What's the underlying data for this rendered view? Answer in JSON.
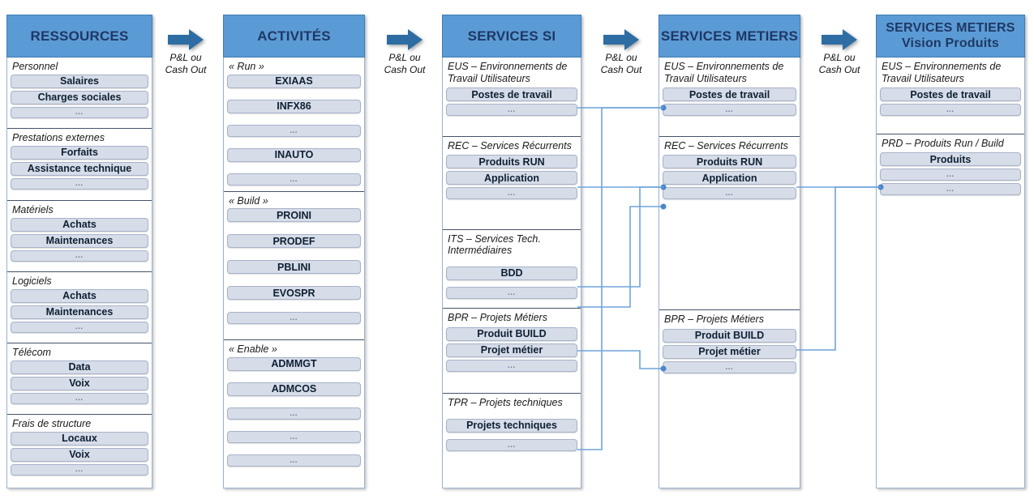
{
  "diagram": {
    "title": "Chaine de valeur IT - Ressources vers Services Metiers",
    "colors": {
      "header_blue": "#5B9BD5",
      "header_text": "#1F3864",
      "pill_fill": "#D6DCE8",
      "pill_border": "#A6B3CA",
      "arrow_blue": "#2E6DA4",
      "connector_blue": "#5B9BD5",
      "section_divider": "#44546A"
    },
    "connector_label": "P&L ou Cash Out",
    "connector_label_line1": "P&L ou",
    "connector_label_line2": "Cash Out",
    "arrow_icon": "right-block-arrow"
  },
  "columns": [
    {
      "id": "ressources",
      "header_lines": [
        "RESSOURCES"
      ],
      "sections": [
        {
          "title": "Personnel",
          "items": [
            "Salaires",
            "Charges sociales",
            "…"
          ]
        },
        {
          "title": "Prestations externes",
          "items": [
            "Forfaits",
            "Assistance technique",
            "…"
          ]
        },
        {
          "title": "Matériels",
          "items": [
            "Achats",
            "Maintenances",
            "…"
          ]
        },
        {
          "title": "Logiciels",
          "items": [
            "Achats",
            "Maintenances",
            "…"
          ]
        },
        {
          "title": "Télécom",
          "items": [
            "Data",
            "Voix",
            "…"
          ]
        },
        {
          "title": "Frais de structure",
          "items": [
            "Locaux",
            "Voix",
            "…"
          ]
        }
      ]
    },
    {
      "id": "activites",
      "header_lines": [
        "ACTIVITÉS"
      ],
      "sections": [
        {
          "title": "« Run »",
          "items": [
            "EXIAAS",
            "INFX86",
            "…",
            "INAUTO",
            "…"
          ]
        },
        {
          "title": "« Build »",
          "items": [
            "PROINI",
            "PRODEF",
            "PBLINI",
            "EVOSPR",
            "…"
          ]
        },
        {
          "title": "« Enable »",
          "items": [
            "ADMMGT",
            "ADMCOS",
            "…",
            "…",
            "…"
          ]
        }
      ]
    },
    {
      "id": "services-si",
      "header_lines": [
        "SERVICES SI"
      ],
      "sections": [
        {
          "title": "EUS – Environnements de Travail Utilisateurs",
          "items": [
            "Postes de travail",
            "…"
          ]
        },
        {
          "title": "REC – Services Récurrents",
          "items": [
            "Produits RUN",
            "Application",
            "…"
          ]
        },
        {
          "title": "ITS – Services Tech. Intermédiaires",
          "items": [
            "BDD",
            "…"
          ]
        },
        {
          "title": "BPR – Projets Métiers",
          "items": [
            "Produit BUILD",
            "Projet métier",
            "…"
          ]
        },
        {
          "title": "TPR – Projets techniques",
          "items": [
            "Projets techniques",
            "…"
          ]
        }
      ]
    },
    {
      "id": "services-metiers",
      "header_lines": [
        "SERVICES METIERS"
      ],
      "sections": [
        {
          "title": "EUS – Environnements de Travail Utilisateurs",
          "items": [
            "Postes de travail",
            "…"
          ]
        },
        {
          "title": "REC – Services Récurrents",
          "items": [
            "Produits RUN",
            "Application",
            "…"
          ]
        },
        {
          "title": "BPR – Projets Métiers",
          "items": [
            "Produit BUILD",
            "Projet métier",
            "…"
          ]
        }
      ]
    },
    {
      "id": "services-metiers-vision-produits",
      "header_lines": [
        "SERVICES METIERS",
        "Vision Produits"
      ],
      "sections": [
        {
          "title": "EUS – Environnements de Travail Utilisateurs",
          "items": [
            "Postes de travail",
            "…"
          ]
        },
        {
          "title": "PRD – Produits Run / Build",
          "items": [
            "Produits",
            "…",
            "…"
          ]
        }
      ]
    }
  ],
  "flow_arrows": [
    {
      "id": "arrow-ressources-activites",
      "label_line1": "P&L ou",
      "label_line2": "Cash Out"
    },
    {
      "id": "arrow-activites-services-si",
      "label_line1": "P&L ou",
      "label_line2": "Cash Out"
    },
    {
      "id": "arrow-services-si-services-metiers",
      "label_line1": "P&L ou",
      "label_line2": "Cash Out"
    },
    {
      "id": "arrow-services-metiers-vision",
      "label_line1": "P&L ou",
      "label_line2": "Cash Out"
    }
  ]
}
